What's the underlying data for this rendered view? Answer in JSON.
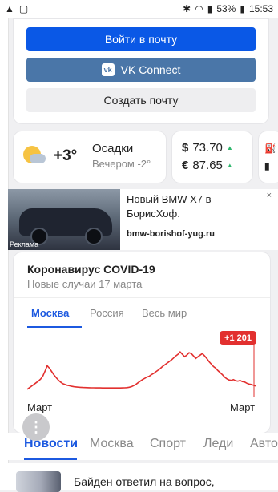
{
  "status_bar": {
    "battery": "53%",
    "time": "15:53"
  },
  "mail": {
    "login_label": "Войти в почту",
    "vk_icon_text": "vk",
    "vk_label": "VK Connect",
    "create_label": "Создать почту"
  },
  "weather": {
    "temp": "+3°",
    "title": "Осадки",
    "sub": "Вечером -2°"
  },
  "rates": [
    {
      "symbol": "$",
      "value": "73.70"
    },
    {
      "symbol": "€",
      "value": "87.65"
    }
  ],
  "ad": {
    "title": "Новый BMW X7 в БорисХоф.",
    "domain": "bmw-borishof-yug.ru",
    "label": "Реклама",
    "close": "×"
  },
  "covid": {
    "title": "Коронавирус COVID-19",
    "subtitle": "Новые случаи 17 марта",
    "tabs": [
      "Москва",
      "Россия",
      "Весь мир"
    ],
    "badge": "+1 201",
    "axis_start": "Март",
    "axis_end": "Март"
  },
  "chart_data": {
    "type": "line",
    "title": "",
    "xlabel": "",
    "ylabel": "",
    "x_labels": [
      "Март",
      "Март"
    ],
    "color": "#e2302f",
    "ylim": [
      0,
      1300
    ],
    "values": [
      180,
      220,
      260,
      300,
      340,
      380,
      430,
      500,
      620,
      760,
      700,
      620,
      540,
      470,
      410,
      360,
      320,
      300,
      280,
      270,
      255,
      245,
      238,
      232,
      228,
      225,
      222,
      220,
      218,
      217,
      216,
      215,
      214,
      214,
      213,
      213,
      212,
      212,
      212,
      212,
      212,
      212,
      213,
      214,
      216,
      220,
      230,
      245,
      270,
      300,
      340,
      380,
      420,
      450,
      480,
      500,
      540,
      570,
      610,
      650,
      690,
      740,
      780,
      820,
      860,
      900,
      950,
      1000,
      1040,
      1100,
      1040,
      980,
      1020,
      1080,
      1060,
      1000,
      940,
      980,
      1020,
      1060,
      1000,
      940,
      860,
      800,
      740,
      700,
      640,
      590,
      540,
      480,
      440,
      410,
      400,
      420,
      390,
      380,
      400,
      370,
      360,
      330,
      310,
      300,
      280,
      260
    ]
  }
}
